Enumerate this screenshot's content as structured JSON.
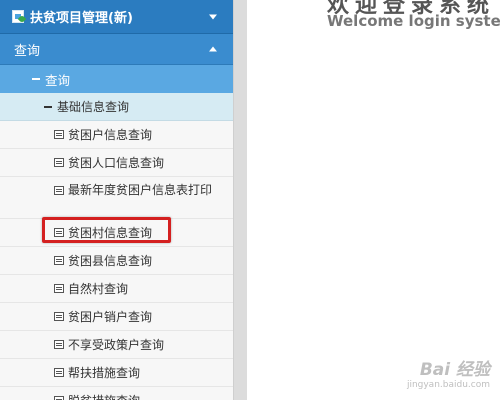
{
  "sidebar": {
    "top_menu": {
      "label": "扶贫项目管理(新)"
    },
    "query_menu": {
      "label": "查询"
    },
    "sub_query": {
      "label": "查询"
    },
    "group": {
      "label": "基础信息查询"
    },
    "items": [
      {
        "label": "贫困户信息查询"
      },
      {
        "label": "贫困人口信息查询"
      },
      {
        "label": "最新年度贫困户信息表打印"
      },
      {
        "label": "贫困村信息查询"
      },
      {
        "label": "贫困县信息查询"
      },
      {
        "label": "自然村查询"
      },
      {
        "label": "贫困户销户查询"
      },
      {
        "label": "不享受政策户查询"
      },
      {
        "label": "帮扶措施查询"
      },
      {
        "label": "脱贫措施查询"
      }
    ]
  },
  "main": {
    "welcome_title_partial": "欢迎登录系统",
    "welcome_subtitle": "Welcome login system"
  },
  "watermark": {
    "brand": "Bai 经验",
    "url": "jingyan.baidu.com"
  },
  "colors": {
    "menu_blue": "#2b7cc0",
    "highlight_red": "#d42020"
  }
}
